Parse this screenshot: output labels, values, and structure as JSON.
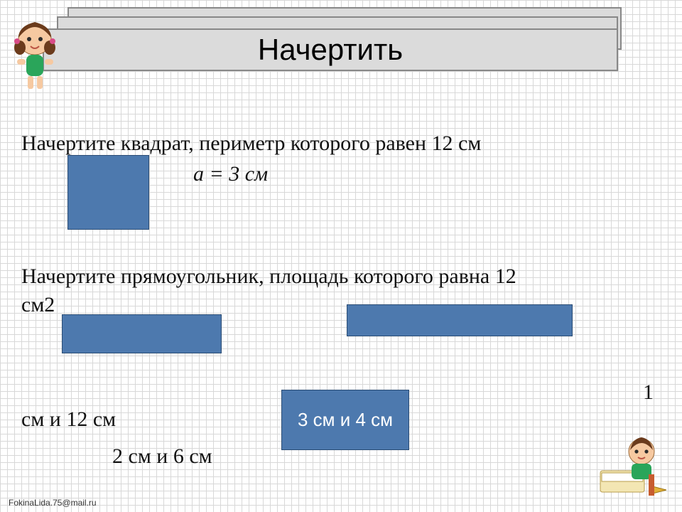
{
  "title": "Начертить",
  "task1": "Начертите квадрат, периметр которого равен 12 см",
  "sideFormula": "a = 3 см",
  "task2a": "Начертите прямоугольник, площадь которого равна 12",
  "task2b": "см2",
  "one": "1",
  "pair1": "см и 12 см",
  "pair2": "2 см и 6 см",
  "boxLabel": "3 см и 4 см",
  "credit": "FokinaLida.75@mail.ru"
}
